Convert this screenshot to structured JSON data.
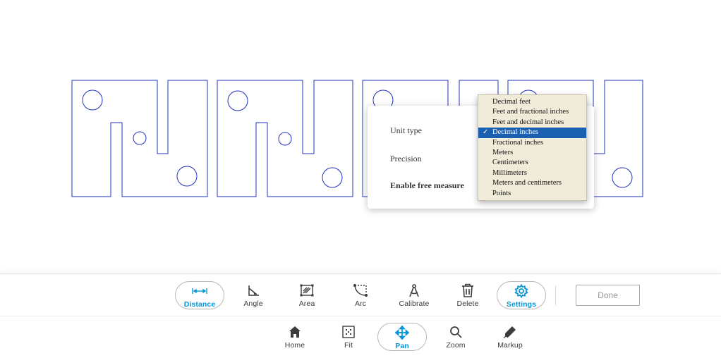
{
  "colors": {
    "accent": "#0696d7",
    "drawing_stroke": "#2233bb",
    "dropdown_bg": "#f1ecd9",
    "dropdown_selected": "#1b5fb0"
  },
  "settings_panel": {
    "unit_type_label": "Unit type",
    "precision_label": "Precision",
    "free_measure_label": "Enable free measure"
  },
  "unit_dropdown": {
    "selected": "Decimal inches",
    "check_mark": "✓",
    "options": [
      "Decimal feet",
      "Feet and fractional inches",
      "Feet and decimal inches",
      "Decimal inches",
      "Fractional inches",
      "Meters",
      "Centimeters",
      "Millimeters",
      "Meters and centimeters",
      "Points"
    ]
  },
  "measure_toolbar": {
    "tools": [
      {
        "label": "Distance",
        "icon": "distance-icon",
        "active": true
      },
      {
        "label": "Angle",
        "icon": "angle-icon",
        "active": false
      },
      {
        "label": "Area",
        "icon": "area-icon",
        "active": false
      },
      {
        "label": "Arc",
        "icon": "arc-icon",
        "active": false
      },
      {
        "label": "Calibrate",
        "icon": "calibrate-icon",
        "active": false
      },
      {
        "label": "Delete",
        "icon": "trash-icon",
        "active": false
      },
      {
        "label": "Settings",
        "icon": "gear-icon",
        "active": true
      }
    ],
    "done_label": "Done"
  },
  "nav_toolbar": {
    "tools": [
      {
        "label": "Home",
        "icon": "home-icon",
        "active": false
      },
      {
        "label": "Fit",
        "icon": "fit-icon",
        "active": false
      },
      {
        "label": "Pan",
        "icon": "pan-icon",
        "active": true
      },
      {
        "label": "Zoom",
        "icon": "zoom-icon",
        "active": false
      },
      {
        "label": "Markup",
        "icon": "pencil-icon",
        "active": false
      }
    ]
  }
}
